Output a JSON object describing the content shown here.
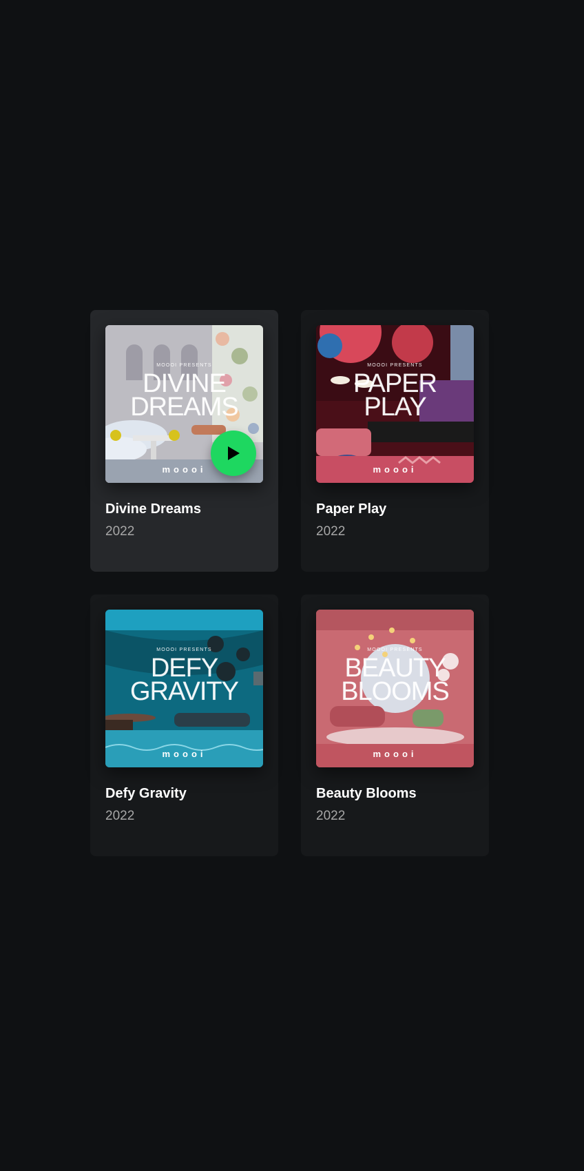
{
  "albums": [
    {
      "title": "Divine Dreams",
      "year": "2022",
      "cover_presents": "MOOOI PRESENTS",
      "cover_title": "DIVINE\nDREAMS",
      "cover_brand": "moooi",
      "active": true
    },
    {
      "title": "Paper Play",
      "year": "2022",
      "cover_presents": "MOOOI PRESENTS",
      "cover_title": "PAPER\nPLAY",
      "cover_brand": "moooi",
      "active": false
    },
    {
      "title": "Defy Gravity",
      "year": "2022",
      "cover_presents": "MOOOI PRESENTS",
      "cover_title": "DEFY\nGRAVITY",
      "cover_brand": "moooi",
      "active": false
    },
    {
      "title": "Beauty Blooms",
      "year": "2022",
      "cover_presents": "MOOOI PRESENTS",
      "cover_title": "BEAUTY\nBLOOMS",
      "cover_brand": "moooi",
      "active": false
    }
  ],
  "play_button": {
    "icon": "play-icon",
    "color": "#1ed760"
  },
  "colors": {
    "background": "#0f1113",
    "card": "#17191b",
    "card_active": "#26282b",
    "title": "#ffffff",
    "subtitle": "#a7a7a7"
  }
}
